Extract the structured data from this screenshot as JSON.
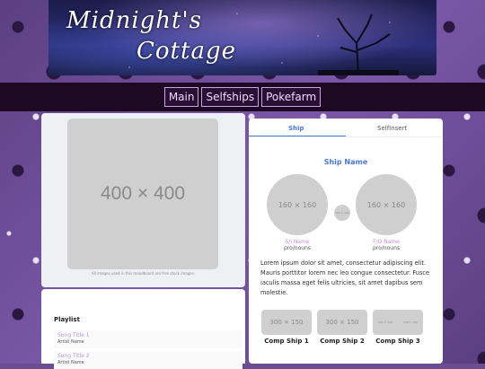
{
  "header": {
    "title_line1": "Midnight's",
    "title_line2": "Cottage"
  },
  "nav": {
    "items": [
      {
        "label": "Main"
      },
      {
        "label": "Selfships"
      },
      {
        "label": "Pokefarm"
      }
    ]
  },
  "left": {
    "image_placeholder": "400 × 400",
    "image_caption": "All images used in this moodboard are free stock images."
  },
  "playlist": {
    "title": "Playlist",
    "songs": [
      {
        "title": "Song Title 1",
        "artist": "Artist Name"
      },
      {
        "title": "Song Title 2",
        "artist": "Artist Name"
      }
    ]
  },
  "ship": {
    "tabs": [
      {
        "label": "Ship",
        "active": true
      },
      {
        "label": "SelfInsert",
        "active": false
      }
    ],
    "ship_name": "Ship Name",
    "left_avatar": "160 × 160",
    "right_avatar": "160 × 160",
    "middle_icon": "100 × 100",
    "left_person": {
      "name": "S/I Name",
      "pronouns": "pro/nouns"
    },
    "right_person": {
      "name": "F/O Name",
      "pronouns": "pro/nouns"
    },
    "description": "Lorem ipsum dolor sit amet, consectetur adipiscing elit. Mauris porttitor lorem nec leo congue consectetur. Fusce iaculis massa eget felis ultricies, sit amet dapibus sem molestie.",
    "comp_ships": [
      {
        "label": "Comp Ship 1",
        "image": "300 × 150"
      },
      {
        "label": "Comp Ship 2",
        "image": "300 × 150"
      },
      {
        "label": "Comp Ship 3",
        "image_left": "150 × 150",
        "image_right": "150 × 150"
      }
    ]
  },
  "colors": {
    "accent": "#4a78d4",
    "navbar_bg": "#1d0a22",
    "pink_label": "#c58ad8"
  }
}
